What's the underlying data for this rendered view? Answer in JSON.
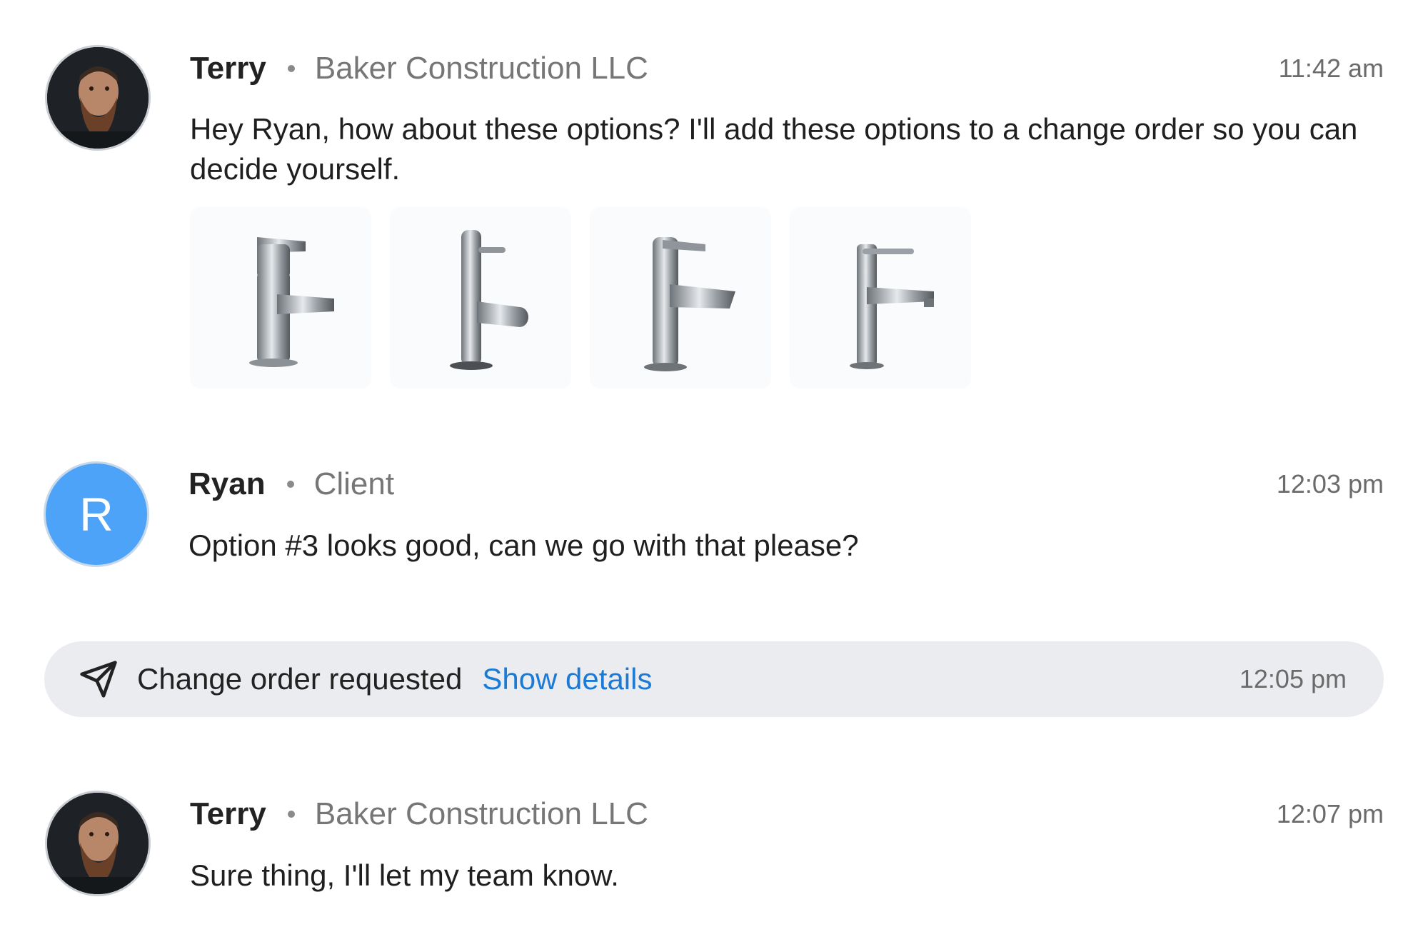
{
  "messages": [
    {
      "name": "Terry",
      "org": "Baker Construction LLC",
      "time": "11:42 am",
      "text": "Hey Ryan, how about these options? I'll add these options to a change order so you can decide yourself.",
      "attachments": [
        "faucet-option-1",
        "faucet-option-2",
        "faucet-option-3",
        "faucet-option-4"
      ]
    },
    {
      "name": "Ryan",
      "org": "Client",
      "avatar_letter": "R",
      "time": "12:03 pm",
      "text": "Option #3 looks good, can we go with that please?"
    },
    {
      "name": "Terry",
      "org": "Baker Construction LLC",
      "time": "12:07 pm",
      "text": "Sure thing, I'll let my team know."
    }
  ],
  "event": {
    "icon": "send-icon",
    "label": "Change order requested",
    "link": "Show details",
    "time": "12:05 pm"
  },
  "colors": {
    "link": "#1a7ad6",
    "avatar_letter_bg": "#4da3f7",
    "event_bg": "#ebecef"
  }
}
